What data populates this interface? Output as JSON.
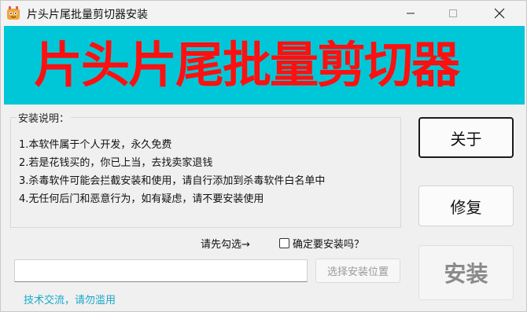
{
  "window": {
    "title": "片头片尾批量剪切器安装",
    "icon": "app-icon",
    "controls": {
      "minimize": "minimize-icon",
      "maximize": "maximize-icon",
      "close": "close-icon"
    }
  },
  "banner": {
    "title": "片头片尾批量剪切器",
    "bg_color": "#00c7d8",
    "text_color": "#ff1010"
  },
  "instructions": {
    "title": "安装说明：",
    "lines": [
      "1.本软件属于个人开发，永久免费",
      "2.若是花钱买的，你已上当，去找卖家退钱",
      "3.杀毒软件可能会拦截安装和使用，请自行添加到杀毒软件白名单中",
      "4.无任何后门和恶意行为，如有疑虑，请不要安装使用"
    ]
  },
  "buttons": {
    "about": "关于",
    "repair": "修复",
    "install": "安装",
    "select_location": "选择安装位置"
  },
  "confirm": {
    "hint": "请先勾选→",
    "checkbox_label": "确定要安装吗？",
    "checked": false
  },
  "install_path": {
    "value": "",
    "placeholder": ""
  },
  "footer": {
    "link": "技术交流，请勿滥用",
    "link_color": "#18a9c9"
  }
}
